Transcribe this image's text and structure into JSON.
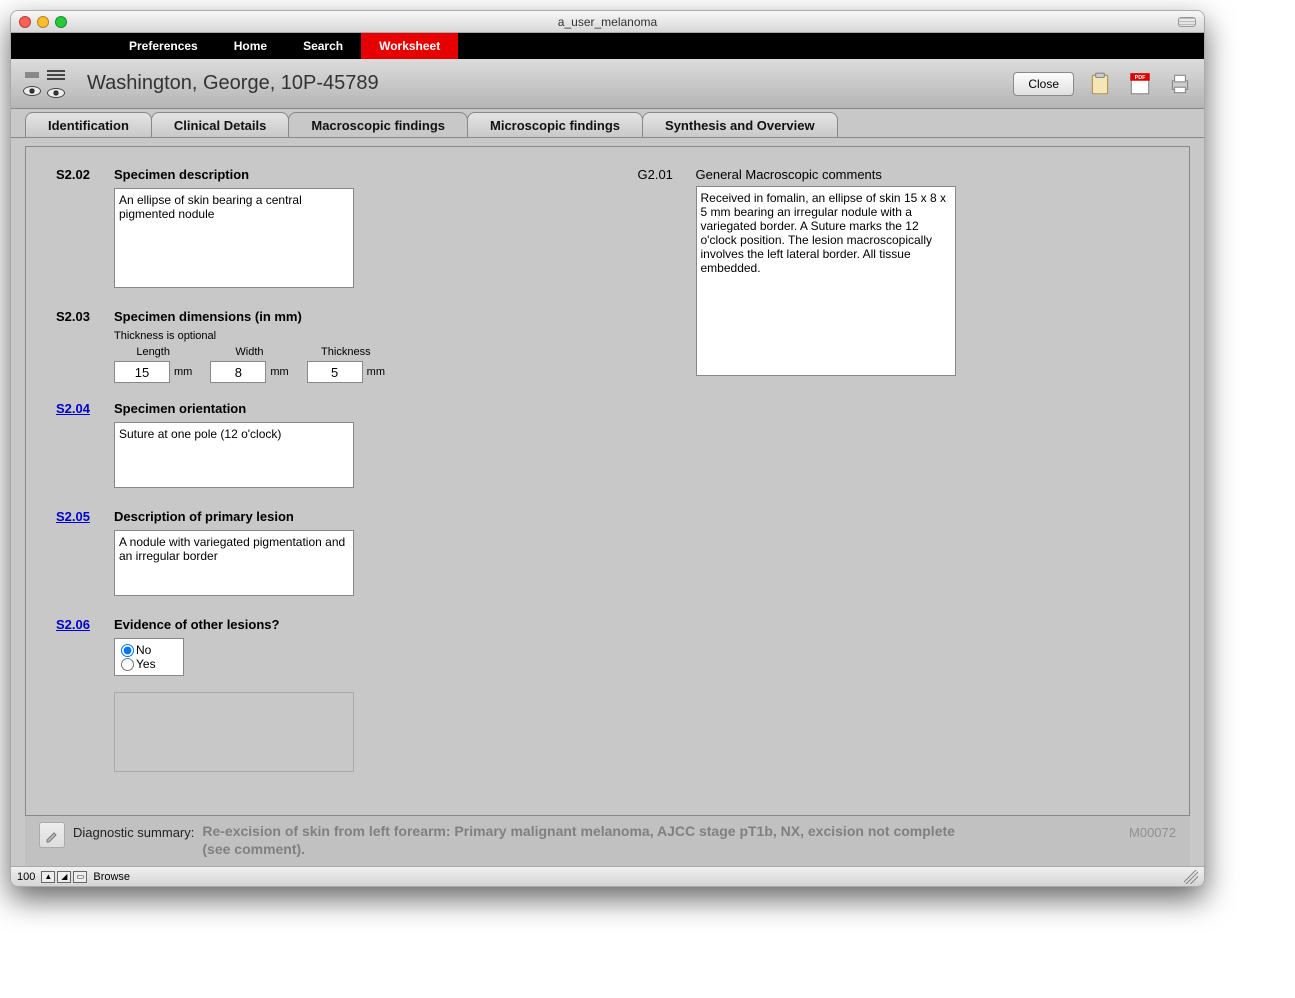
{
  "window": {
    "title": "a_user_melanoma"
  },
  "menubar": {
    "items": [
      "Preferences",
      "Home",
      "Search",
      "Worksheet"
    ],
    "active_index": 3
  },
  "header": {
    "patient": "Washington, George, 10P-45789",
    "close_label": "Close"
  },
  "tabs": {
    "items": [
      "Identification",
      "Clinical Details",
      "Macroscopic findings",
      "Microscopic findings",
      "Synthesis and Overview"
    ],
    "active_index": 2
  },
  "left": {
    "s202": {
      "code": "S2.02",
      "title": "Specimen description",
      "value": "An ellipse of skin bearing a central pigmented nodule"
    },
    "s203": {
      "code": "S2.03",
      "title": "Specimen dimensions (in mm)",
      "note": "Thickness is optional",
      "length_label": "Length",
      "width_label": "Width",
      "thickness_label": "Thickness",
      "length": "15",
      "width": "8",
      "thickness": "5",
      "unit": "mm"
    },
    "s204": {
      "code": "S2.04",
      "title": "Specimen orientation",
      "value": "Suture at one pole (12 o'clock)"
    },
    "s205": {
      "code": "S2.05",
      "title": "Description of primary lesion",
      "value": "A nodule with variegated pigmentation and an irregular border"
    },
    "s206": {
      "code": "S2.06",
      "title": "Evidence of other lesions?",
      "option_no": "No",
      "option_yes": "Yes",
      "selected": "No"
    }
  },
  "right": {
    "g201": {
      "code": "G2.01",
      "title": "General Macroscopic comments",
      "value": "Received in fomalin, an ellipse of skin 15 x 8 x 5 mm bearing an irregular nodule with a variegated border. A Suture marks the 12 o'clock position. The lesion macroscopically involves the left lateral border. All tissue embedded."
    }
  },
  "footer": {
    "label": "Diagnostic summary:",
    "summary": "Re-excision of skin from left forearm: Primary malignant melanoma, AJCC stage pT1b, NX, excision not complete (see comment).",
    "mcode": "M00072"
  },
  "statusbar": {
    "zoom": "100",
    "mode": "Browse"
  }
}
